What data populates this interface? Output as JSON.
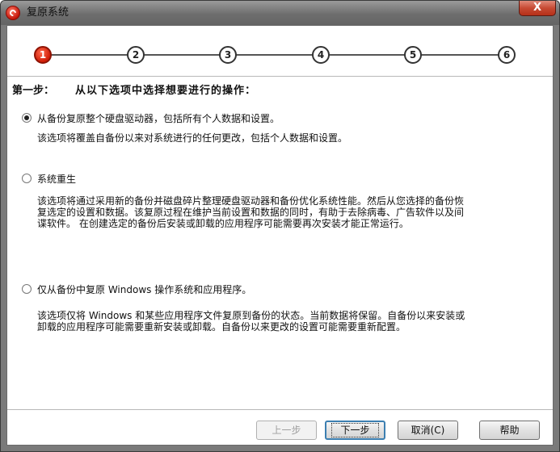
{
  "window": {
    "title": "复原系统",
    "close_label": "X"
  },
  "steps": [
    "1",
    "2",
    "3",
    "4",
    "5",
    "6"
  ],
  "active_step": 1,
  "heading": {
    "step_label": "第一步：",
    "instruction": "从以下选项中选择想要进行的操作："
  },
  "options": [
    {
      "label": "从备份复原整个硬盘驱动器，包括所有个人数据和设置。",
      "checked": true,
      "description": [
        "该选项将覆盖自备份以来对系统进行的任何更改，包括个人数据和设置。"
      ]
    },
    {
      "label": "系统重生",
      "checked": false,
      "description": [
        "该选项将通过采用新的备份并磁盘碎片整理硬盘驱动器和备份优化系统性能。然后从您选择的备份恢",
        "复选定的设置和数据。该复原过程在维护当前设置和数据的同时，有助于去除病毒、广告软件以及间",
        "谍软件。 在创建选定的备份后安装或卸载的应用程序可能需要再次安装才能正常运行。"
      ]
    },
    {
      "label": "仅从备份中复原 Windows 操作系统和应用程序。",
      "checked": false,
      "description": [
        "该选项仅将 Windows 和某些应用程序文件复原到备份的状态。当前数据将保留。自备份以来安装或",
        "卸载的应用程序可能需要重新安装或卸载。自备份以来更改的设置可能需要重新配置。"
      ]
    }
  ],
  "buttons": {
    "back": "上一步",
    "next": "下一步",
    "cancel": "取消(C)",
    "help": "帮助"
  }
}
